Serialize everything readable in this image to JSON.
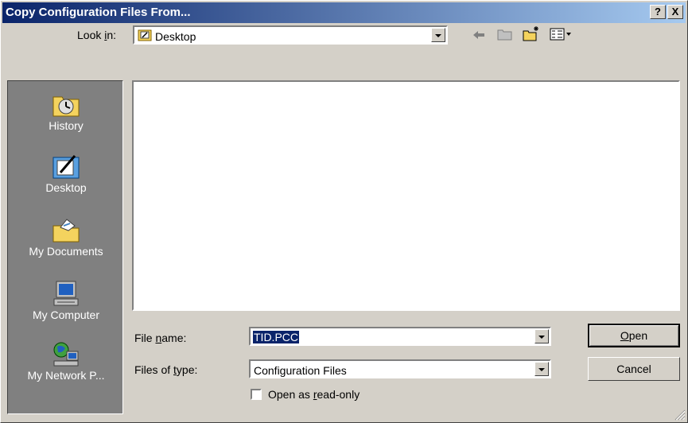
{
  "title": "Copy Configuration Files From...",
  "titlebar": {
    "help_label": "?",
    "close_label": "X"
  },
  "lookin": {
    "label": "Look in:",
    "label_mnemonic": "i",
    "value": "Desktop"
  },
  "toolbar": {
    "icons": [
      "back-icon",
      "up-folder-icon",
      "new-folder-icon",
      "view-menu-icon"
    ]
  },
  "places": [
    {
      "label": "History",
      "icon": "history-icon"
    },
    {
      "label": "Desktop",
      "icon": "desktop-icon"
    },
    {
      "label": "My Documents",
      "icon": "my-documents-icon"
    },
    {
      "label": "My Computer",
      "icon": "my-computer-icon"
    },
    {
      "label": "My Network P...",
      "icon": "network-icon"
    }
  ],
  "filename": {
    "label": "File name:",
    "value": "TID.PCC"
  },
  "filetype": {
    "label": "Files of type:",
    "value": "Configuration Files"
  },
  "readonly": {
    "label": "Open as read-only",
    "checked": false
  },
  "buttons": {
    "open": "Open",
    "cancel": "Cancel"
  }
}
